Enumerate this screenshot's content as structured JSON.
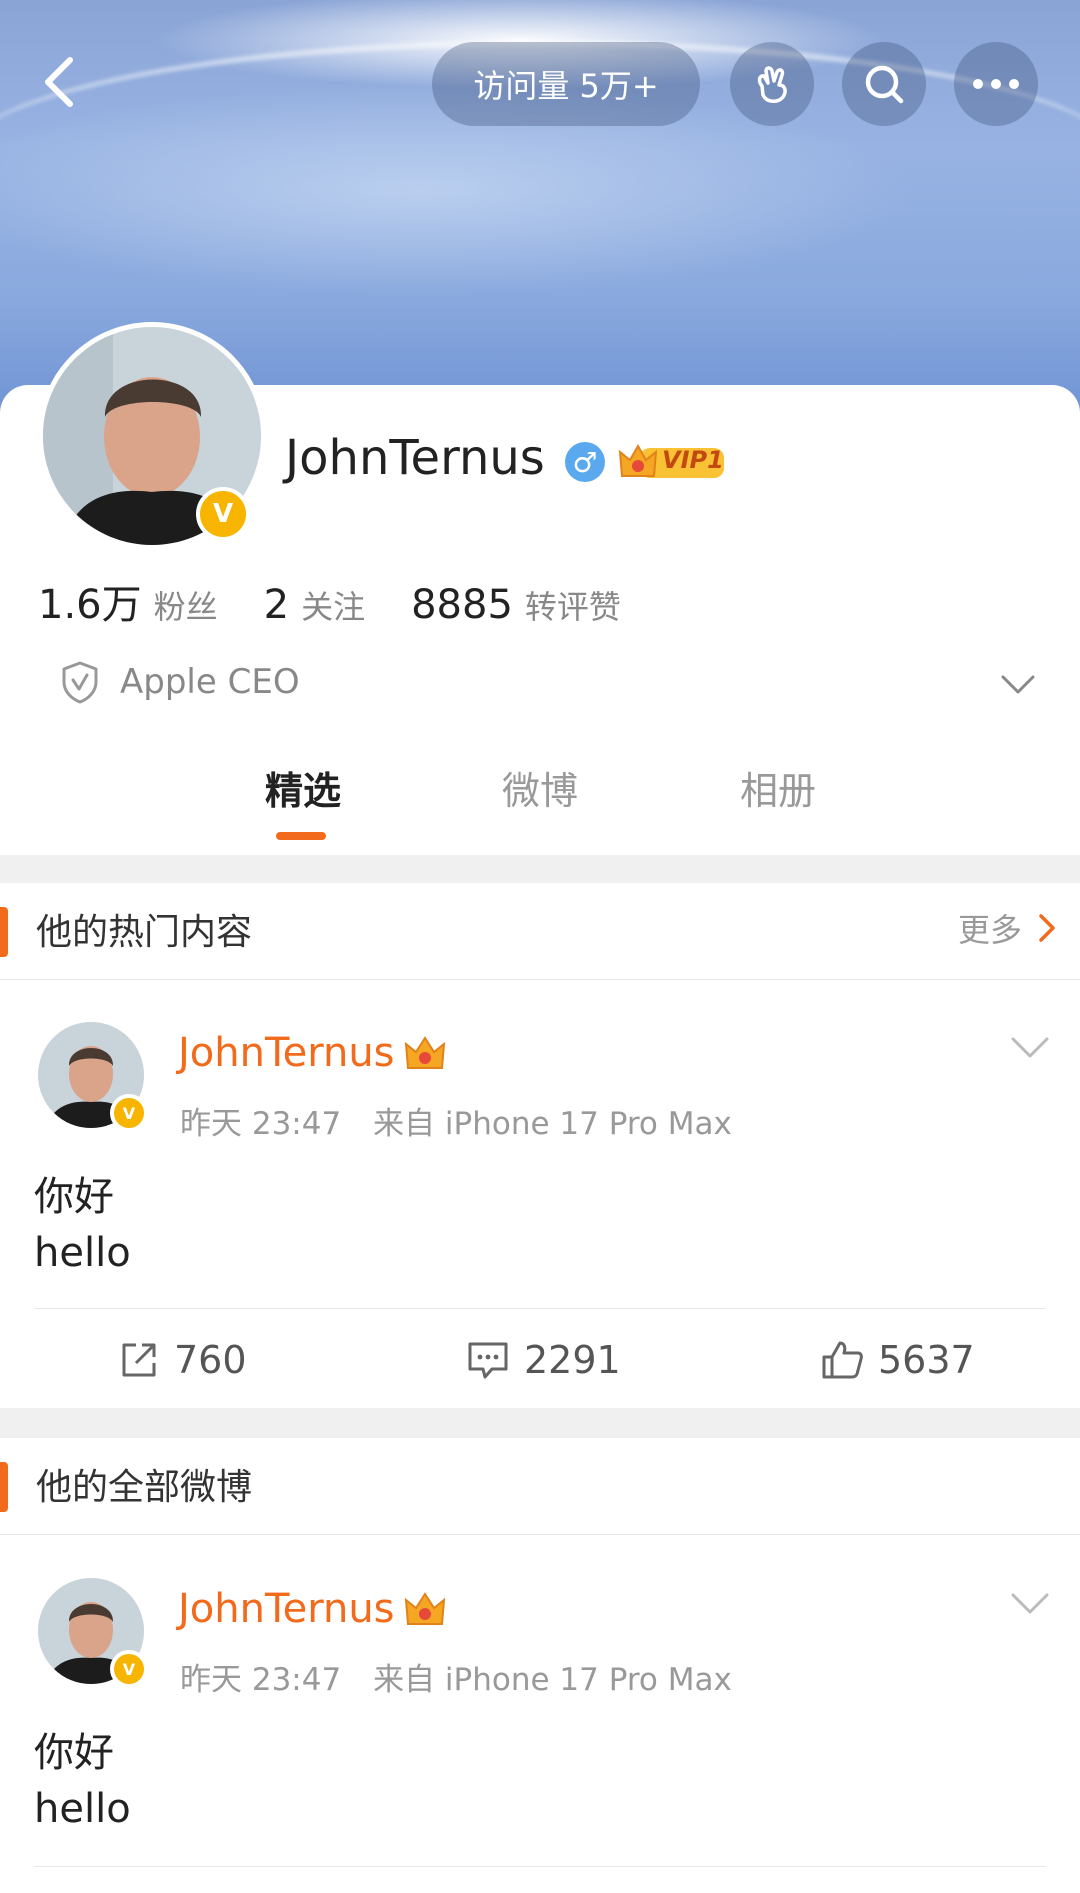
{
  "header": {
    "visits_label": "访问量 5万+"
  },
  "profile": {
    "name": "JohnTernus",
    "gender_symbol": "♂",
    "vip_label": "VIP1",
    "stats": [
      {
        "value": "1.6万",
        "label": "粉丝"
      },
      {
        "value": "2",
        "label": "关注"
      },
      {
        "value": "8885",
        "label": "转评赞"
      }
    ],
    "bio": "Apple CEO"
  },
  "tabs": [
    {
      "label": "精选",
      "active": true
    },
    {
      "label": "微博",
      "active": false
    },
    {
      "label": "相册",
      "active": false
    }
  ],
  "sections": {
    "hot": {
      "title": "他的热门内容",
      "more_label": "更多"
    },
    "all": {
      "title": "他的全部微博"
    }
  },
  "posts": [
    {
      "author": "JohnTernus",
      "time": "昨天 23:47",
      "source": "来自 iPhone 17 Pro Max",
      "line1": "你好",
      "line2": "hello",
      "reposts": "760",
      "comments": "2291",
      "likes": "5637"
    },
    {
      "author": "JohnTernus",
      "time": "昨天 23:47",
      "source": "来自 iPhone 17 Pro Max",
      "line1": "你好",
      "line2": "hello"
    }
  ],
  "colors": {
    "accent": "#f26a1b",
    "verified": "#f7b500",
    "gender": "#5aa9ef"
  }
}
